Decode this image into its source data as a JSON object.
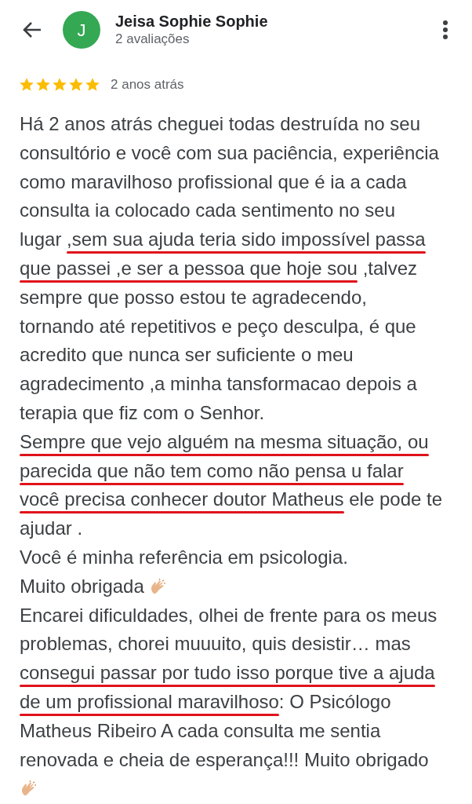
{
  "reviewer": {
    "initial": "J",
    "name": "Jeisa Sophie Sophie",
    "review_count": "2 avaliações"
  },
  "review": {
    "stars": 5,
    "time": "2 anos atrás",
    "lines": [
      {
        "segments": [
          {
            "text": "Há 2 anos atrás cheguei todas destruída no seu",
            "underlined": false
          }
        ]
      },
      {
        "segments": [
          {
            "text": "consultório e você com sua paciência, experiência",
            "underlined": false
          }
        ]
      },
      {
        "segments": [
          {
            "text": "como maravilhoso profissional que é ia a cada",
            "underlined": false
          }
        ]
      },
      {
        "segments": [
          {
            "text": "consulta ia colocado cada sentimento no seu",
            "underlined": false
          }
        ]
      },
      {
        "segments": [
          {
            "text": "lugar ",
            "underlined": false
          },
          {
            "text": ",sem sua ajuda teria sido impossível passa",
            "underlined": true
          }
        ]
      },
      {
        "segments": [
          {
            "text": "que passei ,e ser a pessoa que hoje sou",
            "underlined": true
          },
          {
            "text": " ,talvez",
            "underlined": false
          }
        ]
      },
      {
        "segments": [
          {
            "text": "sempre que posso estou te agradecendo,",
            "underlined": false
          }
        ]
      },
      {
        "segments": [
          {
            "text": "tornando até repetitivos e peço desculpa, é que",
            "underlined": false
          }
        ]
      },
      {
        "segments": [
          {
            "text": "acredito que nunca ser suficiente o meu",
            "underlined": false
          }
        ]
      },
      {
        "segments": [
          {
            "text": "agradecimento ,a minha tansformacao depois a",
            "underlined": false
          }
        ]
      },
      {
        "segments": [
          {
            "text": "terapia que fiz com o Senhor.",
            "underlined": false
          }
        ]
      },
      {
        "segments": [
          {
            "text": "Sempre que vejo alguém na mesma situação, ou",
            "underlined": true
          }
        ]
      },
      {
        "segments": [
          {
            "text": "parecida que não tem como não pensa u falar",
            "underlined": true
          }
        ]
      },
      {
        "segments": [
          {
            "text": "você precisa conhecer doutor Matheus",
            "underlined": true
          },
          {
            "text": " ele pode te",
            "underlined": false
          }
        ]
      },
      {
        "segments": [
          {
            "text": "ajudar .",
            "underlined": false
          }
        ]
      },
      {
        "segments": [
          {
            "text": "Você é minha referência em psicologia.",
            "underlined": false
          }
        ]
      },
      {
        "segments": [
          {
            "text": "Muito obrigada ",
            "underlined": false
          },
          {
            "kind": "clap"
          }
        ]
      },
      {
        "segments": [
          {
            "text": "Encarei dificuldades, olhei de frente para os meus",
            "underlined": false
          }
        ]
      },
      {
        "segments": [
          {
            "text": "problemas, chorei muuuito, quis desistir… mas",
            "underlined": false
          }
        ]
      },
      {
        "segments": [
          {
            "text": "consegui passar por tudo isso porque tive a ajuda",
            "underlined": true
          }
        ]
      },
      {
        "segments": [
          {
            "text": "de um profissional maravilhoso",
            "underlined": true
          },
          {
            "text": ": O Psicólogo",
            "underlined": false
          }
        ]
      },
      {
        "segments": [
          {
            "text": "Matheus Ribeiro A cada consulta me sentia",
            "underlined": false
          }
        ]
      },
      {
        "segments": [
          {
            "text": "renovada e cheia de esperança!!! Muito obrigado",
            "underlined": false
          }
        ]
      },
      {
        "segments": [
          {
            "kind": "clap"
          }
        ]
      }
    ]
  }
}
